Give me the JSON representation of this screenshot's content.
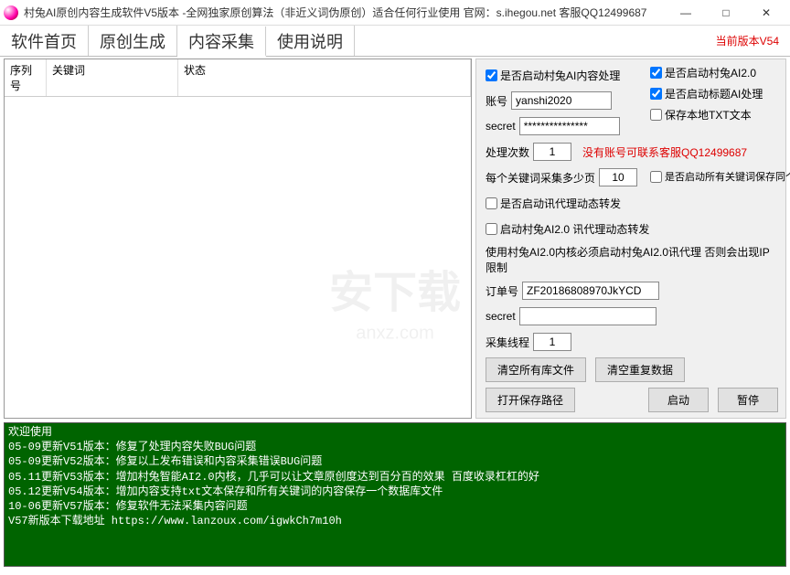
{
  "window": {
    "title": "村兔AI原创内容生成软件V5版本 -全网独家原创算法（非近义词伪原创）适合任何行业使用 官网：s.ihegou.net 客服QQ12499687",
    "minimize": "—",
    "maximize": "□",
    "close": "✕"
  },
  "tabs": {
    "home": "软件首页",
    "generate": "原创生成",
    "collect": "内容采集",
    "help": "使用说明"
  },
  "version_label": "当前版本V54",
  "list": {
    "col_seq": "序列号",
    "col_kw": "关键词",
    "col_status": "状态"
  },
  "right": {
    "chk_ai_content": "是否启动村兔AI内容处理",
    "chk_ai2": "是否启动村兔AI2.0",
    "lbl_account": "账号",
    "val_account": "yanshi2020",
    "chk_title_ai": "是否启动标题AI处理",
    "lbl_secret": "secret",
    "val_secret": "***************",
    "chk_save_txt": "保存本地TXT文本",
    "lbl_process_count": "处理次数",
    "val_process_count": "1",
    "no_account_tip": "没有账号可联系客服QQ12499687",
    "lbl_pages_per_kw": "每个关键词采集多少页",
    "val_pages_per_kw": "10",
    "chk_all_kw_db": "是否启动所有关键词保存同个数据库",
    "chk_xundaili": "是否启动讯代理动态转发",
    "chk_ai2_xundaili": "启动村兔AI2.0 讯代理动态转发",
    "note_ip": "使用村兔AI2.0内核必须启动村兔AI2.0讯代理 否则会出现IP限制",
    "lbl_order": "订单号",
    "val_order": "ZF20186808970JkYCD",
    "lbl_secret2": "secret",
    "val_secret2": "",
    "lbl_threads": "采集线程",
    "val_threads": "1",
    "btn_clear_lib": "清空所有库文件",
    "btn_clear_dup": "清空重复数据",
    "btn_open_path": "打开保存路径",
    "btn_start": "启动",
    "btn_pause": "暂停"
  },
  "log": "欢迎使用\n05-09更新V51版本：修复了处理内容失败BUG问题\n05-09更新V52版本：修复以上发布错误和内容采集错误BUG问题\n05.11更新V53版本：增加村兔智能AI2.0内核，几乎可以让文章原创度达到百分百的效果 百度收录杠杠的好\n05.12更新V54版本：增加内容支持txt文本保存和所有关键词的内容保存一个数据库文件\n10-06更新V57版本：修复软件无法采集内容问题\nV57新版本下载地址 https://www.lanzoux.com/igwkCh7m10h",
  "watermark": {
    "main": "安下载",
    "sub": "anxz.com"
  }
}
